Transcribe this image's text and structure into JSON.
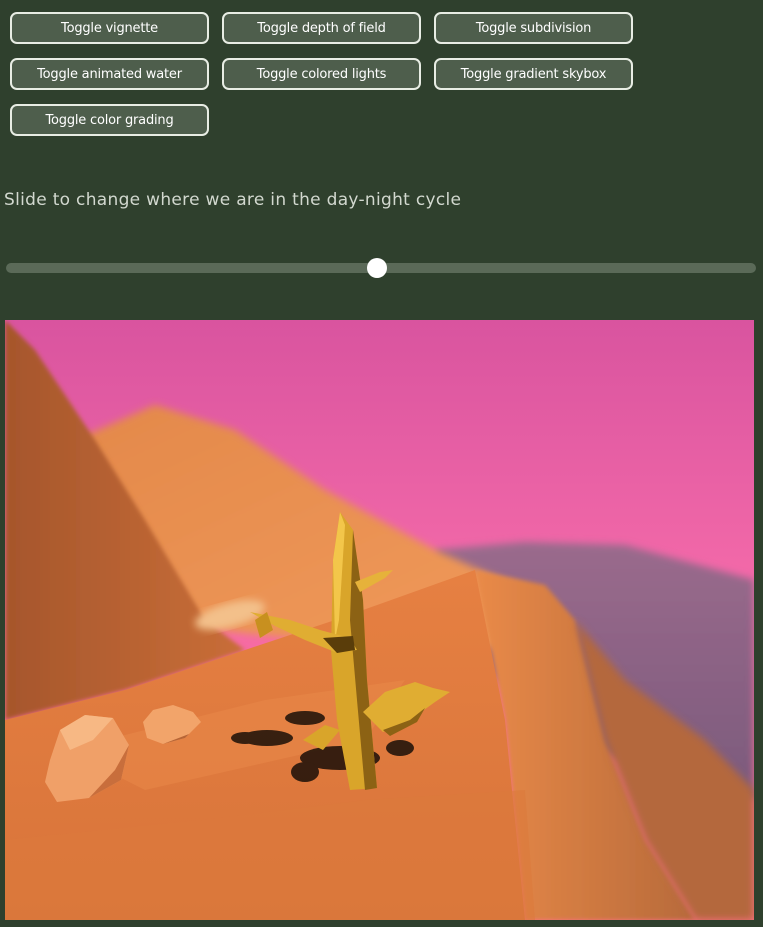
{
  "buttons": [
    {
      "id": "vignette",
      "label": "Toggle vignette"
    },
    {
      "id": "depth-of-field",
      "label": "Toggle depth of field"
    },
    {
      "id": "subdivision",
      "label": "Toggle subdivision"
    },
    {
      "id": "animated-water",
      "label": "Toggle animated water"
    },
    {
      "id": "colored-lights",
      "label": "Toggle colored lights"
    },
    {
      "id": "gradient-skybox",
      "label": "Toggle gradient skybox"
    },
    {
      "id": "color-grading",
      "label": "Toggle color grading"
    }
  ],
  "slider": {
    "caption": "Slide to change where we are in the day-night cycle",
    "value": 0.495
  },
  "colors": {
    "background": "#2f402d",
    "button_fill": "#4e5e4c",
    "button_border": "#e8ede4",
    "sky_top": "#e85fb0",
    "sky_horizon": "#ff7a8a",
    "sand": "#e07d3c",
    "cactus": "#e0b030"
  }
}
